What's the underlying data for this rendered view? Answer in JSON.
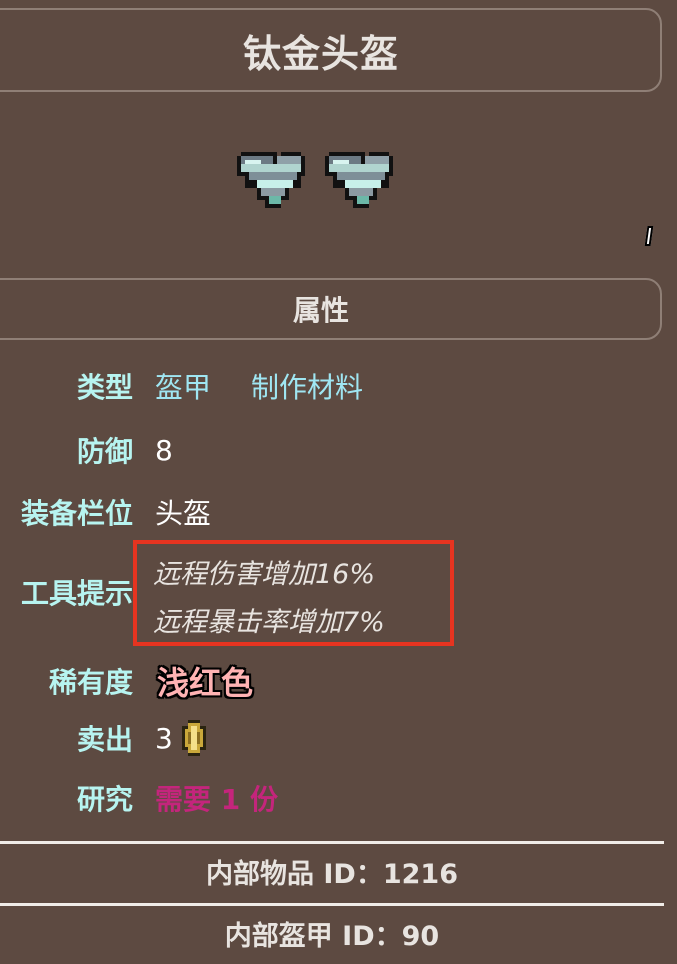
{
  "title": "钛金头盔",
  "section": "属性",
  "rows": {
    "type_label": "类型",
    "type_values": [
      "盔甲",
      "制作材料"
    ],
    "defense_label": "防御",
    "defense_value": "8",
    "slot_label": "装备栏位",
    "slot_value": "头盔",
    "tooltip_label": "工具提示",
    "tooltip_lines": [
      "远程伤害增加16%",
      "远程暴击率增加7%"
    ],
    "rarity_label": "稀有度",
    "rarity_value": "浅红色",
    "sell_label": "卖出",
    "sell_value": "3",
    "research_label": "研究",
    "research_value": "需要 1 份"
  },
  "footer": {
    "item_id": "内部物品 ID：1216",
    "armor_id": "内部盔甲 ID：90"
  },
  "icons": [
    "titanium-helmet-sprite-icon",
    "titanium-helmet-sprite-icon",
    "gold-coin-icon"
  ],
  "colors": {
    "background": "#5d4a41",
    "label": "#b7f4f0",
    "link": "#9fe6f2",
    "rarity": "#ffb3b3",
    "research": "#c4257c",
    "highlight_box": "#e63420"
  }
}
